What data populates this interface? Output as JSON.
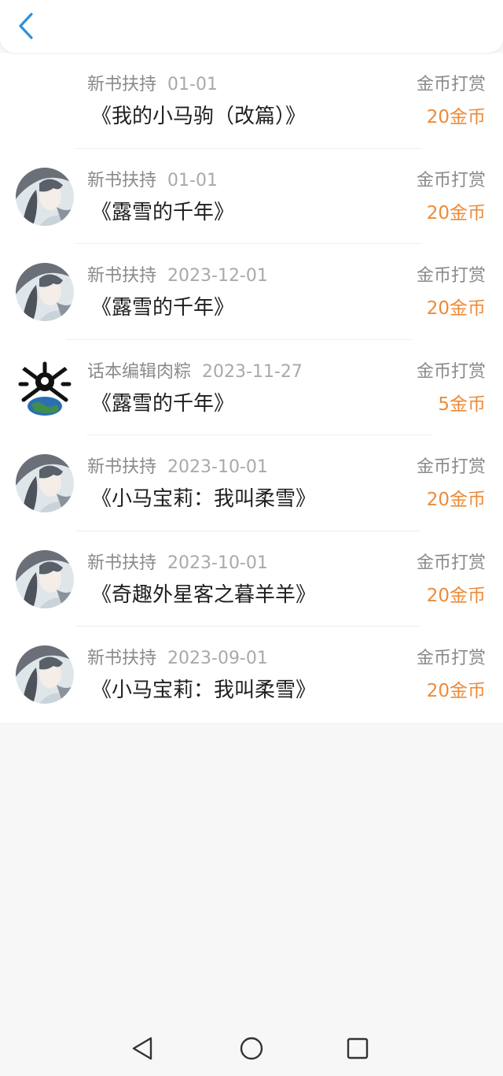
{
  "header": {
    "back_icon": "chevron-left-icon",
    "accent_color": "#2f8fd8"
  },
  "colors": {
    "amount": "#ee8a37",
    "title": "#1f1f1f",
    "meta": "#8a8a8a"
  },
  "records": [
    {
      "sender": "新书扶持",
      "date": "01-01",
      "book": "《我的小马驹（改篇）》",
      "kind": "金币打赏",
      "amount": "20金币",
      "avatar": "none"
    },
    {
      "sender": "新书扶持",
      "date": "01-01",
      "book": "《露雪的千年》",
      "kind": "金币打赏",
      "amount": "20金币",
      "avatar": "anime-portrait"
    },
    {
      "sender": "新书扶持",
      "date": "2023-12-01",
      "book": "《露雪的千年》",
      "kind": "金币打赏",
      "amount": "20金币",
      "avatar": "anime-portrait"
    },
    {
      "sender": "话本编辑肉粽",
      "date": "2023-11-27",
      "book": "《露雪的千年》",
      "kind": "金币打赏",
      "amount": "5金币",
      "avatar": "skull-globe"
    },
    {
      "sender": "新书扶持",
      "date": "2023-10-01",
      "book": "《小马宝莉：我叫柔雪》",
      "kind": "金币打赏",
      "amount": "20金币",
      "avatar": "anime-portrait"
    },
    {
      "sender": "新书扶持",
      "date": "2023-10-01",
      "book": "《奇趣外星客之暮羊羊》",
      "kind": "金币打赏",
      "amount": "20金币",
      "avatar": "anime-portrait"
    },
    {
      "sender": "新书扶持",
      "date": "2023-09-01",
      "book": "《小马宝莉：我叫柔雪》",
      "kind": "金币打赏",
      "amount": "20金币",
      "avatar": "anime-portrait"
    }
  ],
  "navbar": {
    "back_icon": "triangle-back-icon",
    "home_icon": "circle-home-icon",
    "recents_icon": "square-recents-icon"
  }
}
